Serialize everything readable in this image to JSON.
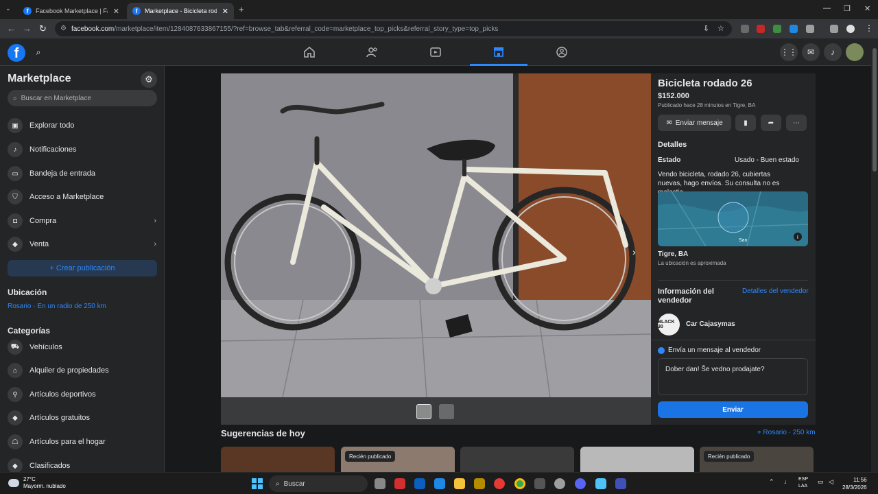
{
  "browser": {
    "tabs": [
      {
        "label": "Facebook Marketplace | Facebo"
      },
      {
        "label": "Marketplace - Bicicleta rodado"
      }
    ],
    "url_host": "facebook.com",
    "url_path": "/marketplace/item/1284087633867155/?ref=browse_tab&referral_code=marketplace_top_picks&referral_story_type=top_picks"
  },
  "sidebar": {
    "title": "Marketplace",
    "search_placeholder": "Buscar en Marketplace",
    "items": [
      {
        "label": "Explorar todo",
        "icon": "shop-icon"
      },
      {
        "label": "Notificaciones",
        "icon": "bell-icon"
      },
      {
        "label": "Bandeja de entrada",
        "icon": "inbox-icon"
      },
      {
        "label": "Acceso a Marketplace",
        "icon": "shield-icon"
      },
      {
        "label": "Compra",
        "icon": "bag-icon"
      },
      {
        "label": "Venta",
        "icon": "tag-icon"
      }
    ],
    "create_label": "+ Crear publicación",
    "location_heading": "Ubicación",
    "location_value": "Rosario · En un radio de 250 km",
    "categories_heading": "Categorías",
    "categories": [
      {
        "label": "Vehículos",
        "icon": "car-icon"
      },
      {
        "label": "Alquiler de propiedades",
        "icon": "house-icon"
      },
      {
        "label": "Artículos deportivos",
        "icon": "runner-icon"
      },
      {
        "label": "Artículos gratuitos",
        "icon": "tag-icon"
      },
      {
        "label": "Artículos para el hogar",
        "icon": "lamp-icon"
      },
      {
        "label": "Clasificados",
        "icon": "tag-icon"
      }
    ]
  },
  "listing": {
    "title": "Bicicleta rodado 26",
    "price": "$152.000",
    "posted": "Publicado hace 28 minutos en Tigre, BA",
    "message_button": "Enviar mensaje",
    "details_heading": "Detalles",
    "condition_label": "Estado",
    "condition_value": "Usado - Buen estado",
    "description": "Vendo bicicleta, rodado 26, cubiertas nuevas, hago envíos.  Su consulta no es molestia",
    "map_label": "San",
    "location": "Tigre, BA",
    "location_note": "La ubicación es aproximada",
    "seller_heading": "Información del vendedor",
    "seller_details_link": "Detalles del vendedor",
    "seller_avatar_text": "BLACK 30",
    "seller_name": "Car Cajasymas",
    "send_heading": "Envía un mensaje al vendedor",
    "message_text": "Dober dan! Še vedno prodajate?",
    "send_button": "Enviar"
  },
  "suggestions": {
    "heading": "Sugerencias de hoy",
    "location": "Rosario · 250 km",
    "badges": [
      "Recién publicado",
      "Recién publicado"
    ]
  },
  "taskbar": {
    "weather_temp": "27°C",
    "weather_desc": "Mayorm. nublado",
    "search_label": "Buscar",
    "lang": "ESP",
    "lang_sub": "LAA",
    "time": "11:56",
    "date": "28/3/2026"
  },
  "colors": {
    "accent": "#2d88ff",
    "send_button": "#1b74e4",
    "background": "#18191a",
    "surface": "#242526"
  }
}
